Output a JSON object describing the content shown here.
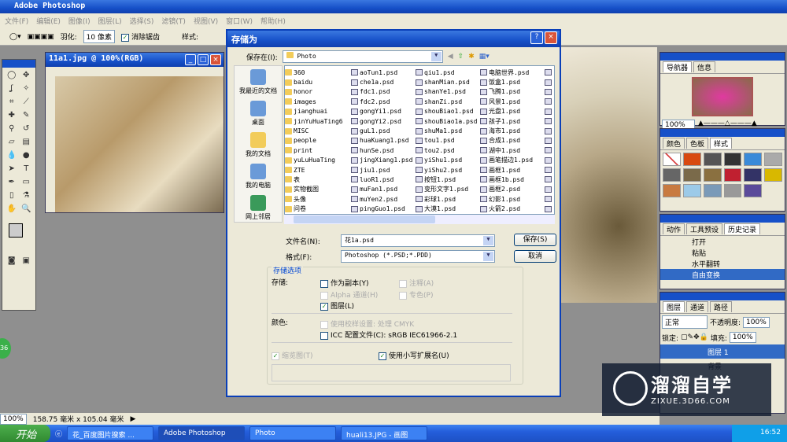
{
  "app": {
    "title": "Adobe Photoshop",
    "menu": [
      "文件(F)",
      "编辑(E)",
      "图像(I)",
      "图层(L)",
      "选择(S)",
      "滤镜(T)",
      "视图(V)",
      "窗口(W)",
      "帮助(H)"
    ]
  },
  "options": {
    "feather_label": "羽化:",
    "feather_value": "10 像素",
    "antialias": "消除锯齿",
    "style_label": "样式:"
  },
  "document": {
    "title": "11a1.jpg @ 100%(RGB)"
  },
  "dialog": {
    "title": "存储为",
    "save_in_label": "保存在(I):",
    "save_in_value": "Photo",
    "places": [
      "我最近的文档",
      "桌面",
      "我的文档",
      "我的电脑",
      "网上邻居"
    ],
    "file_columns": [
      [
        "360",
        "baidu",
        "honor",
        "images",
        "jianghuai",
        "jinYuHuaTing6",
        "MISC",
        "people",
        "print",
        "yuLuHuaTing",
        "ZTE",
        "表",
        "实物截图",
        "头像",
        "问卷"
      ],
      [
        "aoTun1.psd",
        "che1a.psd",
        "fdc1.psd",
        "fdc2.psd",
        "gongYi1.psd",
        "gongYi2.psd",
        "guL1.psd",
        "huaKuang1.psd",
        "hunSe.psd",
        "jingXiang1.psd",
        "jiu1.psd",
        "luoR1.psd",
        "muFan1.psd",
        "muYen2.psd",
        "pingGuo1.psd"
      ],
      [
        "qiu1.psd",
        "shanMian.psd",
        "shanYe1.psd",
        "shanZi.psd",
        "shouBiao1.psd",
        "shouBiao1a.psd",
        "shuMa1.psd",
        "tou1.psd",
        "tou2.psd",
        "yiShu1.psd",
        "yiShu2.psd",
        "按钮1.psd",
        "变形文字1.psd",
        "彩球1.psd",
        "大漠1.psd"
      ],
      [
        "电脑世界.psd",
        "饭盒1.psd",
        "飞腾1.psd",
        "风景1.psd",
        "光盘1.psd",
        "孩子1.psd",
        "海市1.psd",
        "合成1.psd",
        "湖中1.psd",
        "画笔描边1.psd",
        "画框1.psd",
        "画框1b.psd",
        "画框2.psd",
        "幻影1.psd",
        "火箭2.psd"
      ]
    ],
    "filename_label": "文件名(N):",
    "filename_value": "花1a.psd",
    "format_label": "格式(F):",
    "format_value": "Photoshop (*.PSD;*.PDD)",
    "save_button": "保存(S)",
    "cancel_button": "取消",
    "options_legend": "存储选项",
    "save_label": "存储:",
    "as_copy": "作为副本(Y)",
    "notes": "注释(A)",
    "alpha": "Alpha 通道(H)",
    "spot": "专色(P)",
    "layers": "图层(L)",
    "color_label": "颜色:",
    "proof": "使用校样设置: 处理 CMYK",
    "icc": "ICC 配置文件(C): sRGB IEC61966-2.1",
    "thumbnail": "缩览图(T)",
    "lowercase": "使用小写扩展名(U)"
  },
  "panels": {
    "nav_tabs": [
      "导航器",
      "信息"
    ],
    "nav_zoom": "100%",
    "style_tabs": [
      "颜色",
      "色板",
      "样式"
    ],
    "history_tabs": [
      "动作",
      "工具预设",
      "历史记录"
    ],
    "history": [
      "打开",
      "粘贴",
      "水平翻转",
      "自由变换"
    ],
    "layer_tabs": [
      "图层",
      "通道",
      "路径"
    ],
    "blend": "正常",
    "opacity_label": "不透明度:",
    "opacity": "100%",
    "lock_label": "锁定:",
    "fill_label": "填充:",
    "fill": "100%",
    "layers": [
      "图层 1",
      "背景"
    ]
  },
  "status": {
    "zoom": "100%",
    "size": "158.75 毫米 x 105.04 毫米"
  },
  "taskbar": {
    "start": "开始",
    "tasks": [
      "花_百度图片搜索 ...",
      "Adobe Photoshop",
      "Photo",
      "huali13.JPG - 画图"
    ],
    "clock": "16:52"
  },
  "watermark": {
    "title": "溜溜自学",
    "url": "ZIXUE.3D66.COM"
  },
  "badge": "36",
  "colors": {
    "xp_blue": "#1650c8",
    "selection": "#316ac5"
  }
}
